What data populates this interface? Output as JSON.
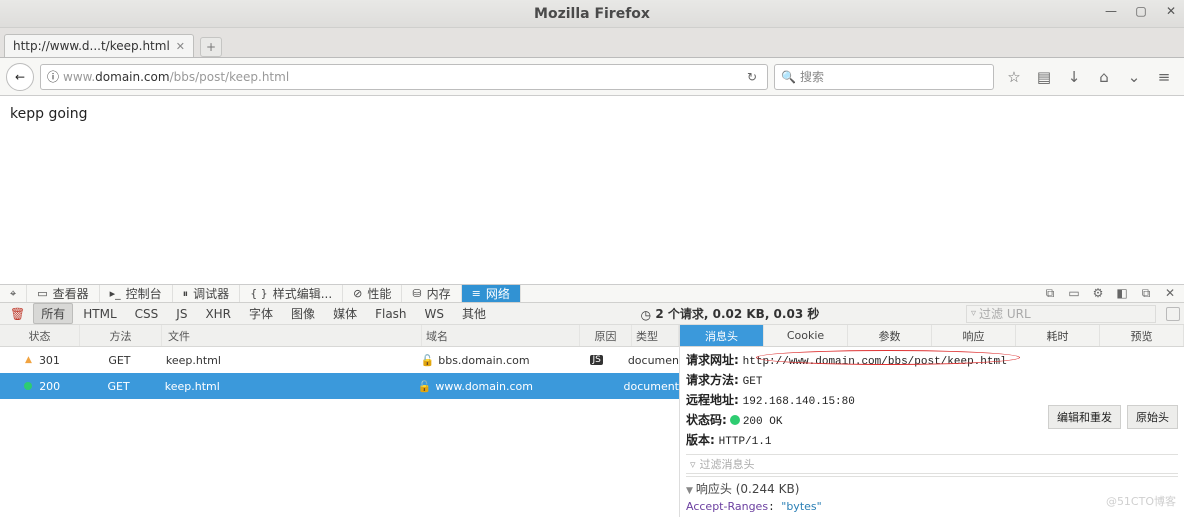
{
  "window": {
    "title": "Mozilla Firefox"
  },
  "tab": {
    "title": "http://www.d...t/keep.html",
    "new_tab": "+"
  },
  "url": {
    "prefix": "www.",
    "domain": "domain.com",
    "path": "/bbs/post/keep.html",
    "info_icon": "ⓘ"
  },
  "search": {
    "placeholder": "搜索"
  },
  "page": {
    "content": "kepp  going"
  },
  "devtabs": {
    "picker": "⌖",
    "inspector": "查看器",
    "console": "控制台",
    "debugger": "调试器",
    "style": "样式编辑...",
    "perf": "性能",
    "memory": "内存",
    "network": "网络"
  },
  "filters": {
    "trash": "🗑",
    "all": "所有",
    "items": [
      "HTML",
      "CSS",
      "JS",
      "XHR",
      "字体",
      "图像",
      "媒体",
      "Flash",
      "WS",
      "其他"
    ],
    "summary": "2 个请求, 0.02 KB, 0.03 秒",
    "url_placeholder": "过滤 URL"
  },
  "columns": {
    "status": "状态",
    "method": "方法",
    "file": "文件",
    "domain": "域名",
    "cause": "原因",
    "type": "类型"
  },
  "requests": [
    {
      "status": "301",
      "method": "GET",
      "file": "keep.html",
      "domain": "bbs.domain.com",
      "type": "documen",
      "selected": false,
      "warn": true,
      "cause_js": true
    },
    {
      "status": "200",
      "method": "GET",
      "file": "keep.html",
      "domain": "www.domain.com",
      "type": "document",
      "selected": true,
      "warn": false,
      "cause_js": false
    }
  ],
  "detail_tabs": {
    "headers": "消息头",
    "cookies": "Cookie",
    "params": "参数",
    "response": "响应",
    "timings": "耗时",
    "preview": "预览"
  },
  "details": {
    "url_label": "请求网址:",
    "url": "http://www.domain.com/bbs/post/keep.html",
    "method_label": "请求方法:",
    "method": "GET",
    "remote_label": "远程地址:",
    "remote": "192.168.140.15:80",
    "status_label": "状态码:",
    "status": "200 OK",
    "version_label": "版本:",
    "version": "HTTP/1.1",
    "filter_headers": "过滤消息头",
    "response_headers": "响应头 (0.244 KB)",
    "accept_k": "Accept-Ranges",
    "accept_v": "\"bytes\"",
    "edit_resend": "编辑和重发",
    "raw": "原始头"
  },
  "watermark": "@51CTO博客"
}
